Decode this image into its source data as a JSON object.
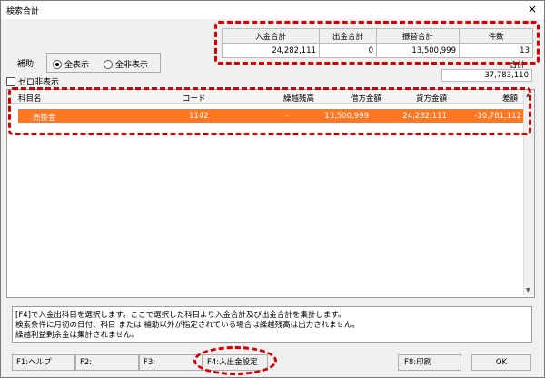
{
  "window": {
    "title": "検索合計",
    "close_glyph": "×"
  },
  "summary": {
    "headers": [
      "入金合計",
      "出金合計",
      "振替合計",
      "件数"
    ],
    "values": [
      "24,282,111",
      "0",
      "13,500,999",
      "13"
    ],
    "total_label": "合計",
    "total_value": "37,783,110"
  },
  "filter": {
    "hojo_label": "補助:",
    "options": [
      "全表示",
      "全非表示"
    ],
    "selected": "全表示",
    "zero_hide_label": "ゼロ非表示",
    "zero_hide_checked": false
  },
  "grid": {
    "headers": [
      "科目名",
      "コード",
      "繰越残高",
      "借方金額",
      "貸方金額",
      "差額"
    ],
    "rows": [
      {
        "name": "売掛金",
        "code": "1142",
        "carry": "-",
        "debit": "13,500,999",
        "credit": "24,282,111",
        "diff": "-10,781,112"
      }
    ]
  },
  "info": {
    "lines": [
      "[F4]で入金出科目を選択します。ここで選択した科目より入金合計及び出金合計を集計します。",
      "検索条件に月初の日付、科目 または 補助以外が指定されている場合は繰越残高は出力されません。",
      "繰越利益剰余金は集計されません。"
    ]
  },
  "buttons": {
    "f1": "F1:ヘルプ",
    "f2": "F2:",
    "f3": "F3:",
    "f4": "F4:入出金設定",
    "f8": "F8:印刷",
    "ok": "OK"
  },
  "colors": {
    "highlight_row": "#ff7722",
    "annotation": "#d60000"
  }
}
